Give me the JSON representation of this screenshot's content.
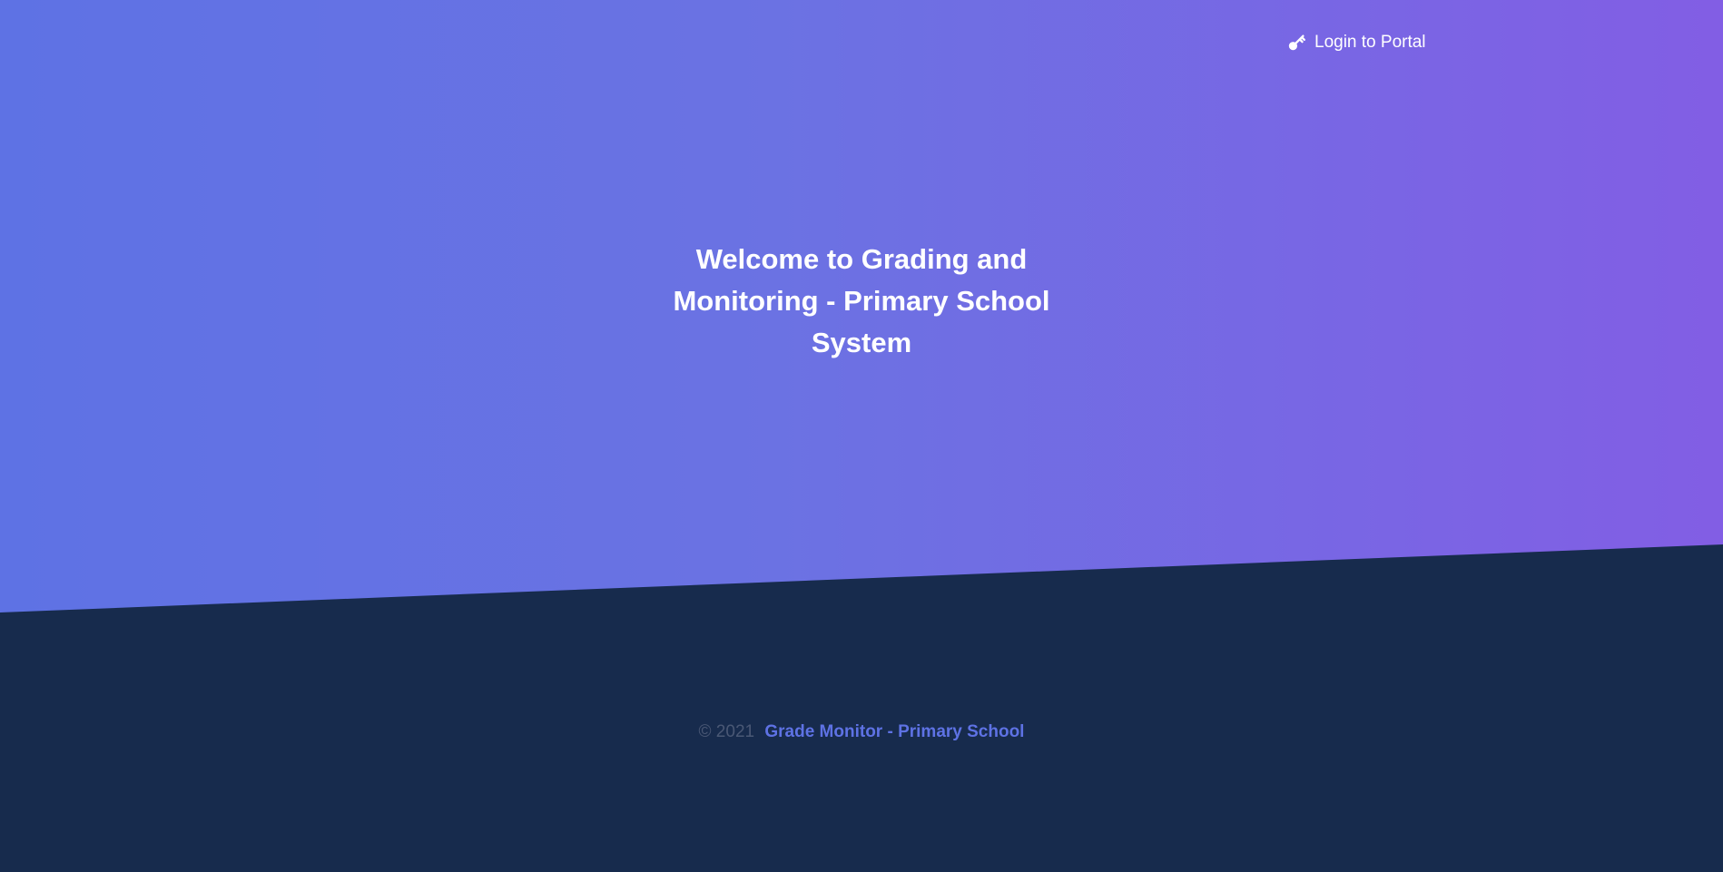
{
  "nav": {
    "login_label": "Login to Portal",
    "login_icon": "key-icon"
  },
  "hero": {
    "headline": "Welcome to Grading and Monitoring - Primary School System"
  },
  "footer": {
    "copyright": "© 2021",
    "brand_link": "Grade Monitor - Primary School"
  },
  "colors": {
    "gradient_start": "#5e72e4",
    "gradient_end": "#825ee4",
    "footer_background": "#172b4d",
    "link_accent": "#5e72e4"
  }
}
